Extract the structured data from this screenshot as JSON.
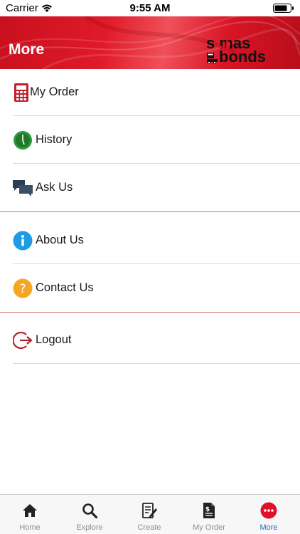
{
  "status_bar": {
    "carrier": "Carrier",
    "time": "9:55 AM"
  },
  "header": {
    "title": "More",
    "logo_line1": "s  mas",
    "logo_line2": "bonds",
    "brand_color": "#d81526"
  },
  "menu": {
    "items": [
      {
        "label": "My Order",
        "icon": "calculator-icon"
      },
      {
        "label": "History",
        "icon": "clock-icon"
      },
      {
        "label": "Ask Us",
        "icon": "chat-bubbles-icon"
      },
      {
        "label": "About Us",
        "icon": "info-icon"
      },
      {
        "label": "Contact Us",
        "icon": "question-icon"
      },
      {
        "label": "Logout",
        "icon": "logout-icon"
      }
    ]
  },
  "tab_bar": {
    "active": "More",
    "tabs": [
      {
        "label": "Home",
        "icon": "home-icon"
      },
      {
        "label": "Explore",
        "icon": "search-icon"
      },
      {
        "label": "Create",
        "icon": "create-icon"
      },
      {
        "label": "My Order",
        "icon": "order-document-icon"
      },
      {
        "label": "More",
        "icon": "more-icon"
      }
    ],
    "active_color": "#1a6fd6",
    "inactive_color": "#8e8e93"
  }
}
